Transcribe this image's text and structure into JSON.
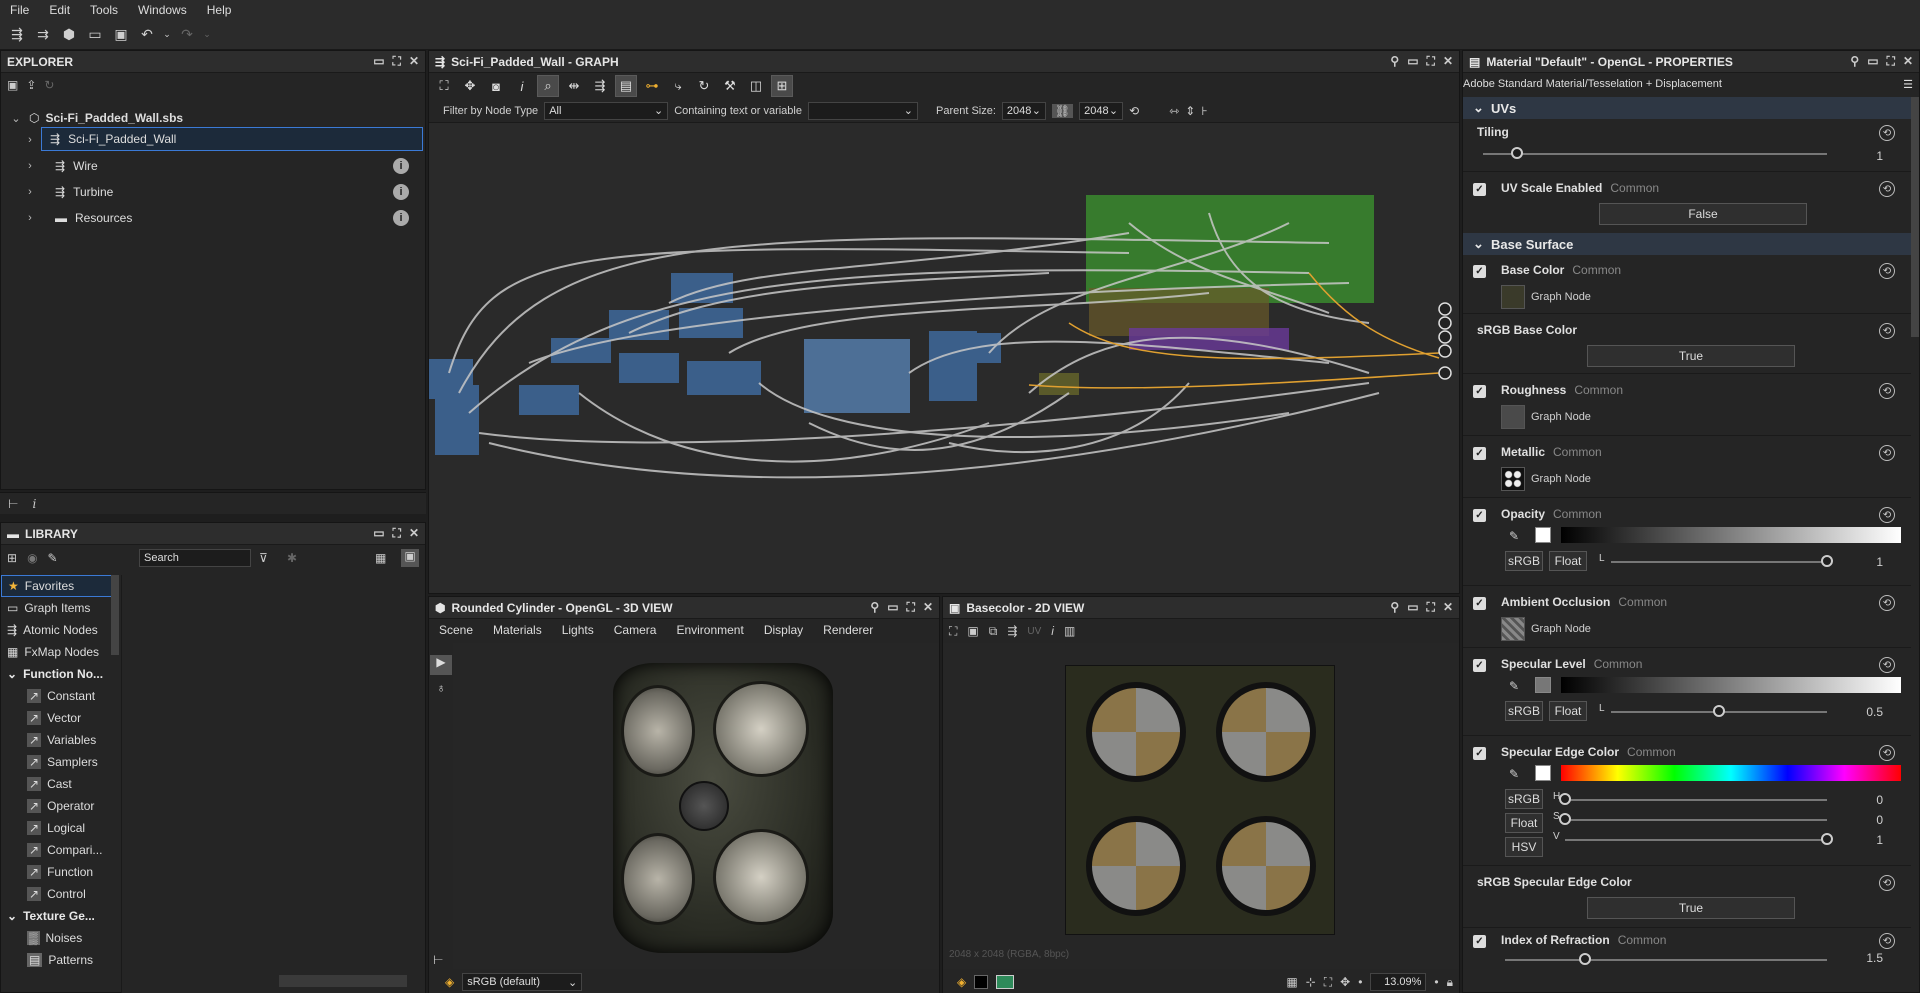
{
  "menubar": {
    "items": [
      "File",
      "Edit",
      "Tools",
      "Windows",
      "Help"
    ]
  },
  "explorer": {
    "title": "EXPLORER",
    "root": "Sci-Fi_Padded_Wall.sbs",
    "items": [
      {
        "label": "Sci-Fi_Padded_Wall",
        "selected": true
      },
      {
        "label": "Wire"
      },
      {
        "label": "Turbine"
      },
      {
        "label": "Resources"
      }
    ]
  },
  "library": {
    "title": "LIBRARY",
    "search_placeholder": "Search",
    "categories": [
      "Favorites",
      "Graph Items",
      "Atomic Nodes",
      "FxMap Nodes"
    ],
    "function_section": "Function No...",
    "function_items": [
      "Constant",
      "Vector",
      "Variables",
      "Samplers",
      "Cast",
      "Operator",
      "Logical",
      "Compari...",
      "Function",
      "Control"
    ],
    "texture_section": "Texture Ge...",
    "texture_items": [
      "Noises",
      "Patterns"
    ]
  },
  "graph": {
    "title": "Sci-Fi_Padded_Wall - GRAPH",
    "filter_label": "Filter by Node Type",
    "filter_value": "All",
    "containing_label": "Containing text or variable",
    "containing_value": "",
    "parent_size_label": "Parent Size:",
    "parent_w": "2048",
    "parent_h": "2048"
  },
  "view3d": {
    "title": "Rounded Cylinder - OpenGL - 3D VIEW",
    "menu": [
      "Scene",
      "Materials",
      "Lights",
      "Camera",
      "Environment",
      "Display",
      "Renderer"
    ],
    "colorspace": "sRGB (default)"
  },
  "view2d": {
    "title": "Basecolor - 2D VIEW",
    "uv_label": "UV",
    "resolution": "2048 x 2048 (RGBA, 8bpc)",
    "zoom": "13.09%"
  },
  "properties": {
    "title": "Material \"Default\" - OpenGL - PROPERTIES",
    "subtitle": "Adobe Standard Material/Tesselation + Displacement",
    "uvs_section": "UVs",
    "tiling_label": "Tiling",
    "tiling_value": "1",
    "tiling_fraction": 0.1,
    "uvscale_label": "UV Scale Enabled",
    "common": "Common",
    "uvscale_value": "False",
    "base_section": "Base Surface",
    "basecolor_label": "Base Color",
    "graph_node": "Graph Node",
    "srgb_base_label": "sRGB Base Color",
    "true_value": "True",
    "roughness_label": "Roughness",
    "metallic_label": "Metallic",
    "opacity_label": "Opacity",
    "srgb_btn": "sRGB",
    "float_btn": "Float",
    "hsv_btn": "HSV",
    "l_label": "L",
    "opacity_value": "1",
    "opacity_fraction": 1.0,
    "ao_label": "Ambient Occlusion",
    "spec_level_label": "Specular Level",
    "spec_level_value": "0.5",
    "spec_level_fraction": 0.5,
    "spec_edge_label": "Specular Edge Color",
    "h_label": "H",
    "s_label": "S",
    "v_label": "V",
    "h_value": "0",
    "s_value": "0",
    "v_value": "1",
    "srgb_spec_edge_label": "sRGB Specular Edge Color",
    "ior_label": "Index of Refraction",
    "ior_value": "1.5"
  }
}
